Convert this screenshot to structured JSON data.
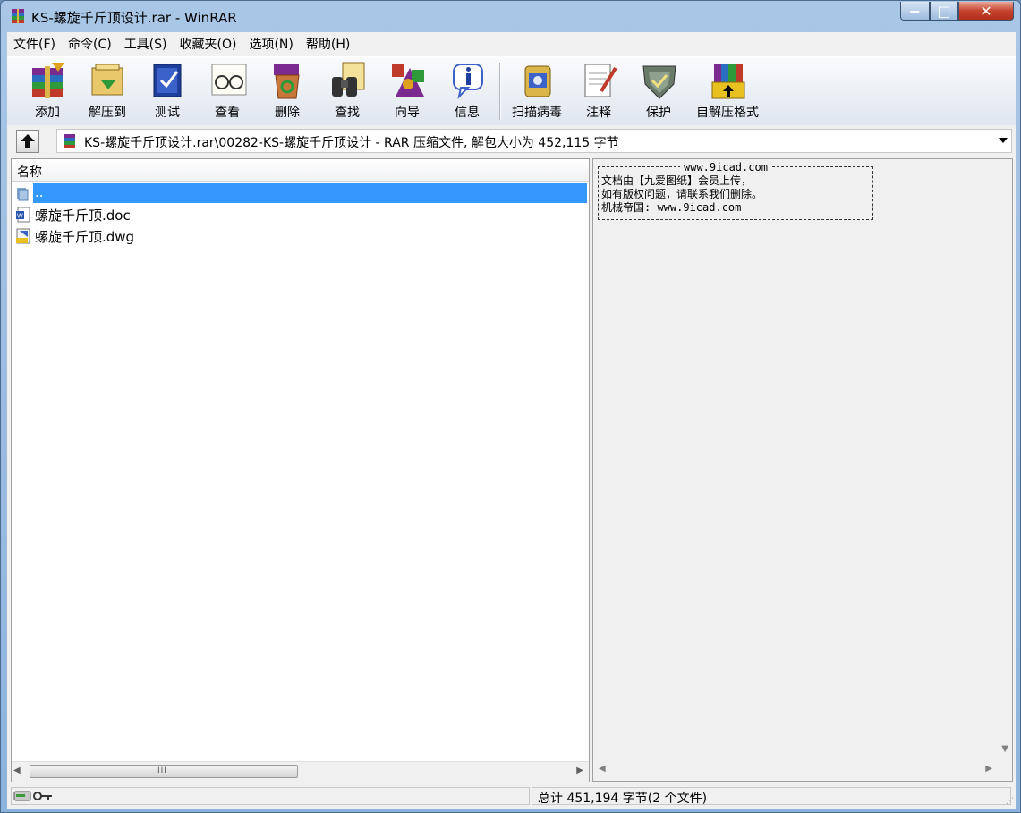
{
  "window": {
    "title": "KS-螺旋千斤顶设计.rar - WinRAR",
    "minimize_symbol": "−",
    "maximize_symbol": "□",
    "close_symbol": "✕"
  },
  "menu": [
    "文件(F)",
    "命令(C)",
    "工具(S)",
    "收藏夹(O)",
    "选项(N)",
    "帮助(H)"
  ],
  "toolbar": {
    "add": "添加",
    "extract": "解压到",
    "test": "测试",
    "view": "查看",
    "delete": "删除",
    "find": "查找",
    "wizard": "向导",
    "info": "信息",
    "virus_scan": "扫描病毒",
    "comment": "注释",
    "protect": "保护",
    "sfx": "自解压格式"
  },
  "address": {
    "path": "KS-螺旋千斤顶设计.rar\\00282-KS-螺旋千斤顶设计 - RAR 压缩文件, 解包大小为 452,115 字节"
  },
  "file_list": {
    "column_name": "名称",
    "rows": [
      {
        "name": "..",
        "icon": "folder-icon",
        "selected": true
      },
      {
        "name": "螺旋千斤顶.doc",
        "icon": "word-doc-icon",
        "selected": false
      },
      {
        "name": "螺旋千斤顶.dwg",
        "icon": "dwg-file-icon",
        "selected": false
      }
    ],
    "scroll_grip": "III"
  },
  "comment": {
    "site": "www.9icad.com",
    "line1": "文档由【九爱图纸】会员上传，",
    "line2": "如有版权问题，请联系我们删除。",
    "line3": "机械帝国: www.9icad.com"
  },
  "status": {
    "total": "总计 451,194 字节(2 个文件)"
  },
  "colors": {
    "selection": "#3399ff",
    "title_bar": "#a9c6e6",
    "close_button": "#c7452f"
  }
}
